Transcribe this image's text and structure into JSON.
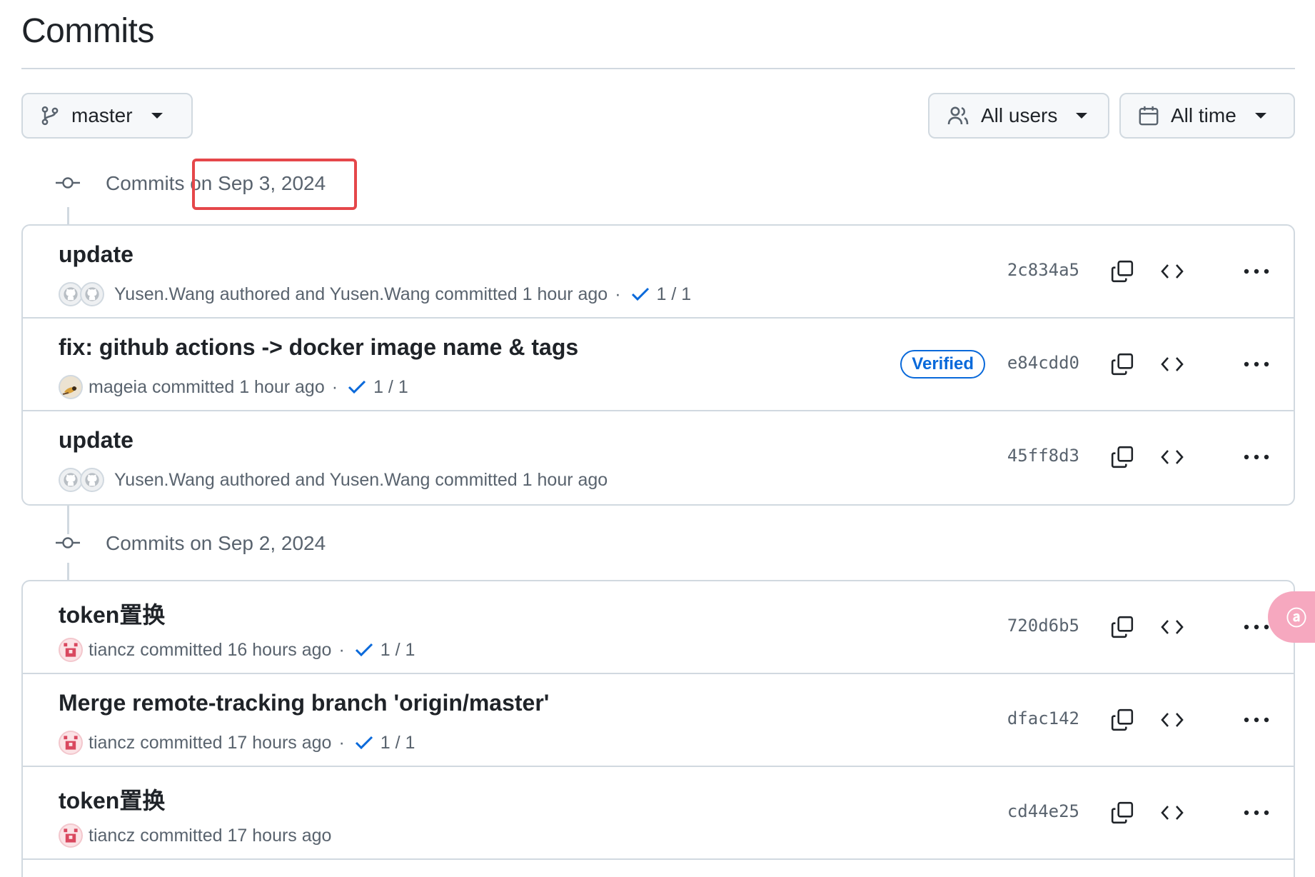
{
  "page": {
    "title": "Commits"
  },
  "filters": {
    "branch": {
      "label": "master",
      "icon": "git-branch-icon"
    },
    "users": {
      "label": "All users",
      "icon": "people-icon"
    },
    "time": {
      "label": "All time",
      "icon": "calendar-icon"
    }
  },
  "groups": [
    {
      "header": "Commits on Sep 3, 2024",
      "commits": [
        {
          "message": "update",
          "author_text": "Yusen.Wang authored and Yusen.Wang committed 1 hour ago",
          "checks": "1 / 1",
          "verified": "",
          "sha": "2c834a5",
          "avatar": "github-default-avatar-pair"
        },
        {
          "message": "fix: github actions -> docker image name & tags",
          "author_text": "mageia committed 1 hour ago",
          "checks": "1 / 1",
          "verified": "Verified",
          "sha": "e84cdd0",
          "avatar": "user-photo-avatar"
        },
        {
          "message": "update",
          "author_text": "Yusen.Wang authored and Yusen.Wang committed 1 hour ago",
          "checks": "",
          "verified": "",
          "sha": "45ff8d3",
          "avatar": "github-default-avatar-pair"
        }
      ]
    },
    {
      "header": "Commits on Sep 2, 2024",
      "commits": [
        {
          "message": "token置换",
          "author_text": "tiancz committed 16 hours ago",
          "checks": "1 / 1",
          "verified": "",
          "sha": "720d6b5",
          "avatar": "identicon-avatar"
        },
        {
          "message": "Merge remote-tracking branch 'origin/master'",
          "author_text": "tiancz committed 17 hours ago",
          "checks": "1 / 1",
          "verified": "",
          "sha": "dfac142",
          "avatar": "identicon-avatar"
        },
        {
          "message": "token置换",
          "author_text": "tiancz committed 17 hours ago",
          "checks": "",
          "verified": "",
          "sha": "cd44e25",
          "avatar": "identicon-avatar"
        }
      ]
    }
  ],
  "annotation": {
    "color": "#e5474a"
  },
  "translate_widget": {
    "label": "ⓐ",
    "color": "#f6a8bf"
  },
  "colors": {
    "check": "#0969da",
    "verified": "#0969da",
    "border": "#d1d9e0",
    "muted": "#59636e"
  }
}
